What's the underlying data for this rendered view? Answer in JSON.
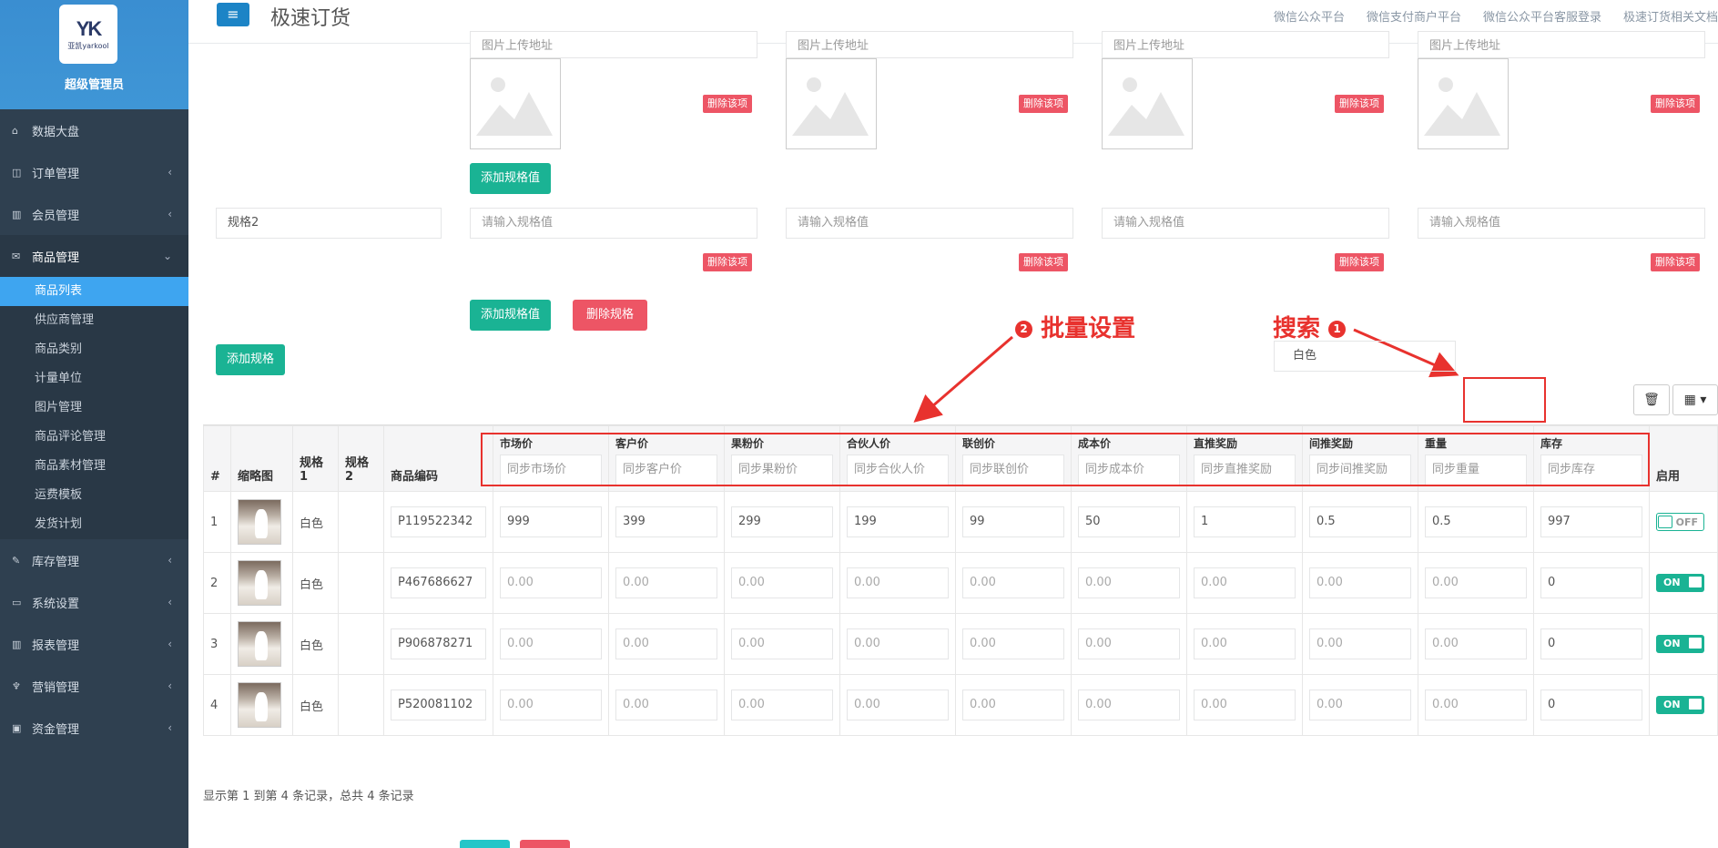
{
  "sidebar": {
    "logo_mark": "YK",
    "logo_sub": "亚凯yarkool",
    "user": "超级管理员",
    "items": [
      {
        "label": "数据大盘",
        "icon": "home-icon",
        "arrow": ""
      },
      {
        "label": "订单管理",
        "icon": "columns-icon",
        "arrow": "‹"
      },
      {
        "label": "会员管理",
        "icon": "bar-chart-icon",
        "arrow": "‹"
      },
      {
        "label": "商品管理",
        "icon": "envelope-icon",
        "arrow": "⌄"
      }
    ],
    "sub_items": [
      "商品列表",
      "供应商管理",
      "商品类别",
      "计量单位",
      "图片管理",
      "商品评论管理",
      "商品素材管理",
      "运费模板",
      "发货计划"
    ],
    "items2": [
      {
        "label": "库存管理",
        "icon": "edit-icon",
        "arrow": "‹"
      },
      {
        "label": "系统设置",
        "icon": "desktop-icon",
        "arrow": "‹"
      },
      {
        "label": "报表管理",
        "icon": "bar-chart-icon",
        "arrow": "‹"
      },
      {
        "label": "营销管理",
        "icon": "cutlery-icon",
        "arrow": "‹"
      },
      {
        "label": "资金管理",
        "icon": "money-icon",
        "arrow": "‹"
      }
    ]
  },
  "header": {
    "menu_icon": "≡",
    "title": "极速订货",
    "links": [
      "微信公众平台",
      "微信支付商户平台",
      "微信公众平台客服登录",
      "极速订货相关文档"
    ]
  },
  "spec1": {
    "url_placeholder": "图片上传地址",
    "delete_label": "删除该项",
    "add_value_label": "添加规格值"
  },
  "spec2": {
    "name": "规格2",
    "value_placeholder": "请输入规格值",
    "delete_label": "删除该项",
    "add_value_label": "添加规格值",
    "delete_spec_label": "删除规格"
  },
  "add_spec_label": "添加规格",
  "annotations": {
    "batch": {
      "num": "2",
      "text": "批量设置"
    },
    "search": {
      "num": "1",
      "text": "搜索"
    }
  },
  "search": {
    "value": "白色"
  },
  "toolbar": {
    "trash_icon": "🗑",
    "columns_icon": "▦ ▾"
  },
  "table": {
    "headers": {
      "index": "#",
      "thumb": "缩略图",
      "spec1": "规格1",
      "spec2": "规格2",
      "code": "商品编码",
      "enable": "启用"
    },
    "sync_columns": [
      {
        "label": "市场价",
        "placeholder": "同步市场价"
      },
      {
        "label": "客户价",
        "placeholder": "同步客户价"
      },
      {
        "label": "果粉价",
        "placeholder": "同步果粉价"
      },
      {
        "label": "合伙人价",
        "placeholder": "同步合伙人价"
      },
      {
        "label": "联创价",
        "placeholder": "同步联创价"
      },
      {
        "label": "成本价",
        "placeholder": "同步成本价"
      },
      {
        "label": "直推奖励",
        "placeholder": "同步直推奖励"
      },
      {
        "label": "间推奖励",
        "placeholder": "同步间推奖励"
      },
      {
        "label": "重量",
        "placeholder": "同步重量"
      },
      {
        "label": "库存",
        "placeholder": "同步库存"
      }
    ],
    "rows": [
      {
        "index": "1",
        "spec1": "白色",
        "spec2": "",
        "code": "P119522342",
        "values": [
          "999",
          "399",
          "299",
          "199",
          "99",
          "50",
          "1",
          "0.5",
          "0.5",
          "997"
        ],
        "placeholders": [
          false,
          false,
          false,
          false,
          false,
          false,
          false,
          false,
          false,
          false
        ],
        "enabled": false,
        "toggle_label": "OFF"
      },
      {
        "index": "2",
        "spec1": "白色",
        "spec2": "",
        "code": "P467686627",
        "values": [
          "0.00",
          "0.00",
          "0.00",
          "0.00",
          "0.00",
          "0.00",
          "0.00",
          "0.00",
          "0.00",
          "0"
        ],
        "placeholders": [
          true,
          true,
          true,
          true,
          true,
          true,
          true,
          true,
          true,
          false
        ],
        "enabled": true,
        "toggle_label": "ON"
      },
      {
        "index": "3",
        "spec1": "白色",
        "spec2": "",
        "code": "P906878271",
        "values": [
          "0.00",
          "0.00",
          "0.00",
          "0.00",
          "0.00",
          "0.00",
          "0.00",
          "0.00",
          "0.00",
          "0"
        ],
        "placeholders": [
          true,
          true,
          true,
          true,
          true,
          true,
          true,
          true,
          true,
          false
        ],
        "enabled": true,
        "toggle_label": "ON"
      },
      {
        "index": "4",
        "spec1": "白色",
        "spec2": "",
        "code": "P520081102",
        "values": [
          "0.00",
          "0.00",
          "0.00",
          "0.00",
          "0.00",
          "0.00",
          "0.00",
          "0.00",
          "0.00",
          "0"
        ],
        "placeholders": [
          true,
          true,
          true,
          true,
          true,
          true,
          true,
          true,
          true,
          false
        ],
        "enabled": true,
        "toggle_label": "ON"
      }
    ]
  },
  "pager": {
    "text": "显示第 1 到第 4 条记录，总共 4 条记录"
  },
  "colors": {
    "primary": "#1c84c6",
    "success": "#1ab394",
    "danger": "#ed5565",
    "annotation": "#e8322e",
    "sidebar": "#2f4050",
    "active_sub": "#3ea5f0"
  }
}
